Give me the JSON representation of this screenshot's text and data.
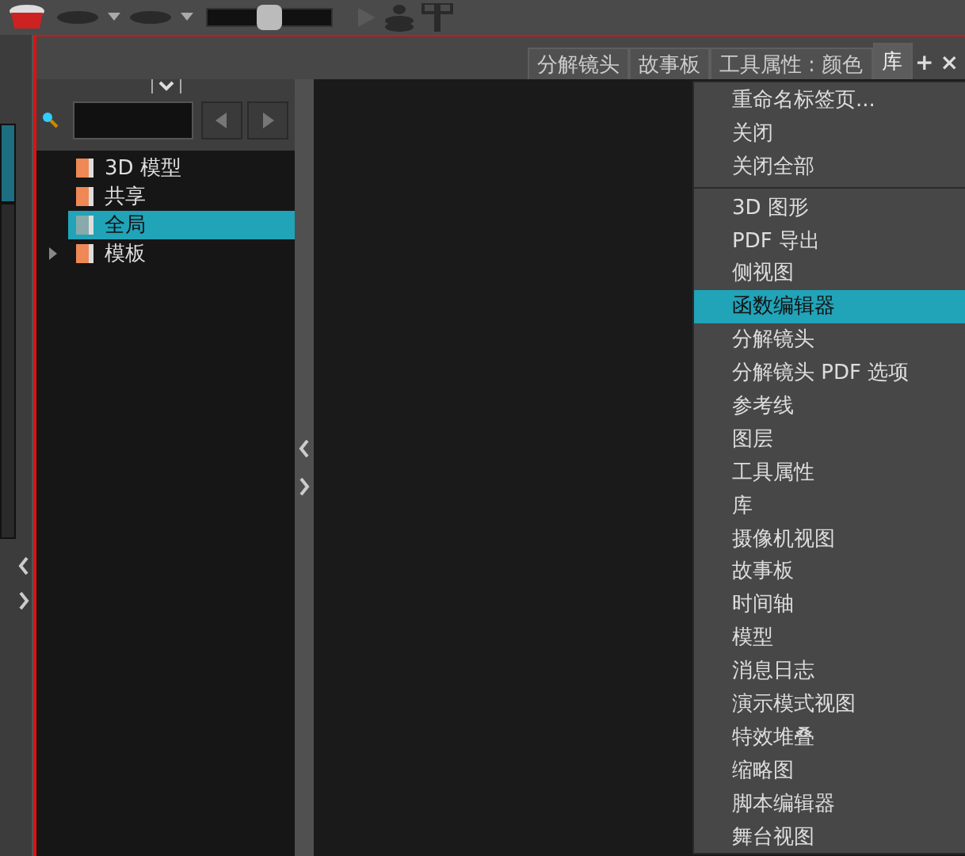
{
  "toolbar": {
    "slider": {
      "level": 0.5
    }
  },
  "tabs": [
    {
      "label": "分解镜头",
      "selected": false
    },
    {
      "label": "故事板",
      "selected": false
    },
    {
      "label": "工具属性 : 颜色",
      "selected": false
    },
    {
      "label": "库",
      "selected": true
    }
  ],
  "tab_actions": [
    "+",
    "×"
  ],
  "library": {
    "tree": [
      {
        "label": "3D 模型",
        "selected": false,
        "has_children": false
      },
      {
        "label": "共享",
        "selected": false,
        "has_children": false
      },
      {
        "label": "全局",
        "selected": true,
        "has_children": false
      },
      {
        "label": "模板",
        "selected": false,
        "has_children": true
      }
    ]
  },
  "context_menu": {
    "items": [
      {
        "label": "重命名标签页...",
        "selected": false,
        "separator_after": false
      },
      {
        "label": "关闭",
        "selected": false,
        "separator_after": false
      },
      {
        "label": "关闭全部",
        "selected": false,
        "separator_after": true
      },
      {
        "label": "3D 图形",
        "selected": false,
        "separator_after": false
      },
      {
        "label": "PDF 导出",
        "selected": false,
        "separator_after": false
      },
      {
        "label": "侧视图",
        "selected": false,
        "separator_after": false
      },
      {
        "label": "函数编辑器",
        "selected": true,
        "separator_after": false
      },
      {
        "label": "分解镜头",
        "selected": false,
        "separator_after": false
      },
      {
        "label": "分解镜头 PDF 选项",
        "selected": false,
        "separator_after": false
      },
      {
        "label": "参考线",
        "selected": false,
        "separator_after": false
      },
      {
        "label": "图层",
        "selected": false,
        "separator_after": false
      },
      {
        "label": "工具属性",
        "selected": false,
        "separator_after": false
      },
      {
        "label": "库",
        "selected": false,
        "separator_after": false
      },
      {
        "label": "摄像机视图",
        "selected": false,
        "separator_after": false
      },
      {
        "label": "故事板",
        "selected": false,
        "separator_after": false
      },
      {
        "label": "时间轴",
        "selected": false,
        "separator_after": false
      },
      {
        "label": "模型",
        "selected": false,
        "separator_after": false
      },
      {
        "label": "消息日志",
        "selected": false,
        "separator_after": false
      },
      {
        "label": "演示模式视图",
        "selected": false,
        "separator_after": false
      },
      {
        "label": "特效堆叠",
        "selected": false,
        "separator_after": false
      },
      {
        "label": "缩略图",
        "selected": false,
        "separator_after": false
      },
      {
        "label": "脚本编辑器",
        "selected": false,
        "separator_after": false
      },
      {
        "label": "舞台视图",
        "selected": false,
        "separator_after": false
      }
    ]
  }
}
